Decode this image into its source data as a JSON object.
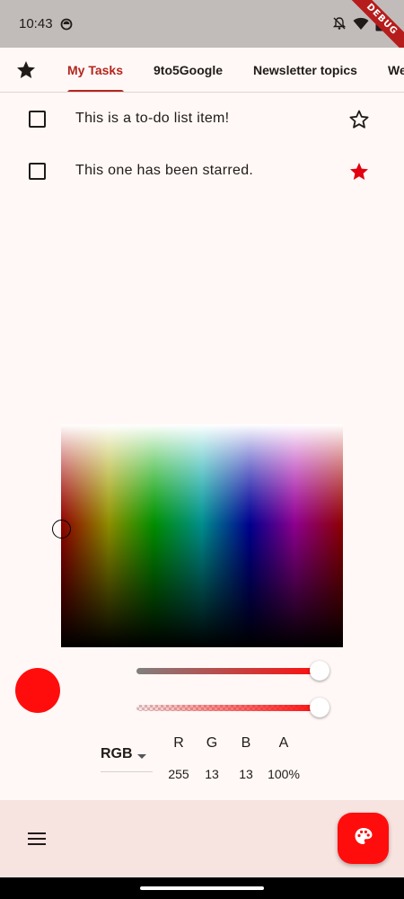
{
  "status_bar": {
    "time": "10:43",
    "debug_label": "DEBUG",
    "icons": [
      "app-status-icon",
      "notifications-off-icon",
      "wifi-icon",
      "battery-icon"
    ]
  },
  "tabs": {
    "starred_icon": "star-filled-icon",
    "items": [
      {
        "label": "My Tasks",
        "active": true
      },
      {
        "label": "9to5Google",
        "active": false
      },
      {
        "label": "Newsletter topics",
        "active": false
      },
      {
        "label": "We",
        "active": false
      }
    ]
  },
  "tasks": [
    {
      "text": "This is a to-do list item!",
      "checked": false,
      "starred": false
    },
    {
      "text": "This one has been starred.",
      "checked": false,
      "starred": true
    }
  ],
  "color_picker": {
    "selected_color": "#FF0D0D",
    "mode": "RGB",
    "channels": [
      {
        "name": "R",
        "value": "255"
      },
      {
        "name": "G",
        "value": "13"
      },
      {
        "name": "B",
        "value": "13"
      },
      {
        "name": "A",
        "value": "100%"
      }
    ],
    "hue_slider_level": 1.0,
    "alpha_slider_level": 1.0
  },
  "bottom_bar": {
    "menu_icon": "menu-icon",
    "fab_icon": "palette-icon"
  },
  "colors": {
    "accent": "#B3261E",
    "star_red": "#E3000F",
    "fab": "#FF0D0D",
    "bottom_bar_bg": "#F7E3E0"
  }
}
